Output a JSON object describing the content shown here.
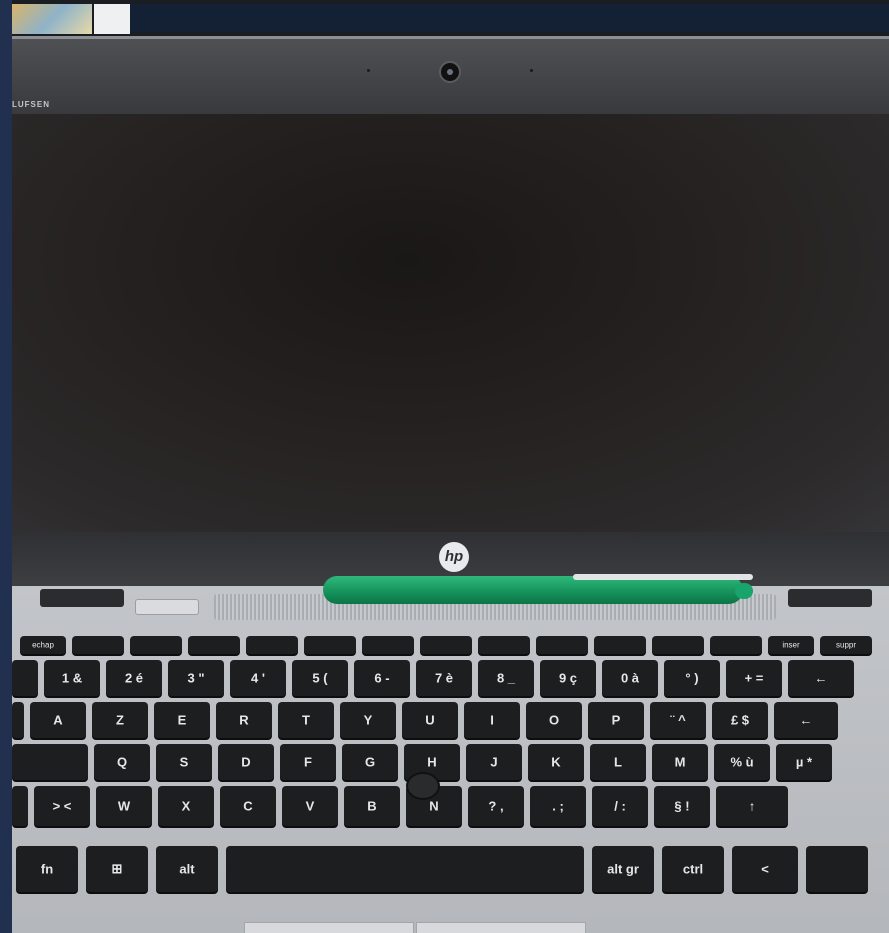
{
  "scene": {
    "brand_text": "LUFSEN",
    "laptop_logo": "hp",
    "colors": {
      "frame": "#20304e",
      "bezel": "#3a3b3e",
      "screen": "#221f1f",
      "deck": "#bfc2c6",
      "keys": "#1d1e20",
      "pen": "#14915a"
    }
  },
  "keyboard": {
    "function_row": [
      "echap",
      "",
      "",
      "",
      "",
      "",
      "",
      "",
      "",
      "",
      "",
      "",
      "",
      "inser",
      "suppr"
    ],
    "number_row": [
      "",
      "1 &",
      "2 é",
      "3 \"",
      "4 '",
      "5 (",
      "6 -",
      "7 è",
      "8 _",
      "9 ç",
      "0 à",
      "° )",
      "+ =",
      "←"
    ],
    "top_row": [
      "",
      "A",
      "Z",
      "E",
      "R",
      "T",
      "Y",
      "U",
      "I",
      "O",
      "P",
      "¨ ^",
      "£ $",
      "←"
    ],
    "home_row": [
      "",
      "Q",
      "S",
      "D",
      "F",
      "G",
      "H",
      "J",
      "K",
      "L",
      "M",
      "% ù",
      "µ *"
    ],
    "bottom_row": [
      "",
      "> <",
      "W",
      "X",
      "C",
      "V",
      "B",
      "N",
      "? ,",
      ". ;",
      "/ :",
      "§ !",
      "↑"
    ],
    "space_row": [
      "fn",
      "⊞",
      "alt",
      "",
      "alt gr",
      "ctrl",
      "<",
      ""
    ]
  }
}
